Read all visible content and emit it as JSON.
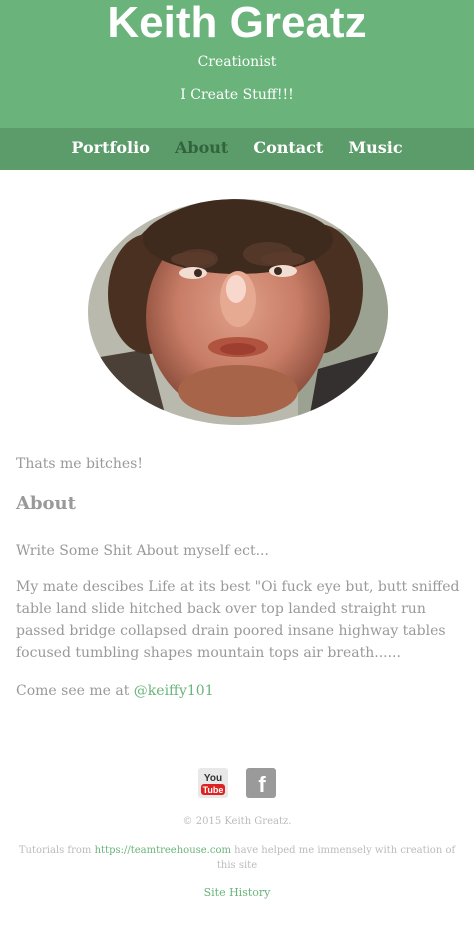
{
  "header": {
    "title": "Keith Greatz",
    "subtitle": "Creationist",
    "tagline": "I Create Stuff!!!"
  },
  "nav": {
    "items": [
      {
        "label": "Portfolio"
      },
      {
        "label": "About",
        "active": true
      },
      {
        "label": "Contact"
      },
      {
        "label": "Music"
      }
    ]
  },
  "profile": {
    "caption": "Thats me bitches!"
  },
  "about": {
    "heading": "About",
    "intro": "Write Some Shit About myself ect...",
    "body": "My mate descibes Life at its best \"Oi fuck eye but, butt sniffed table land slide hitched back over top landed straight run passed bridge collapsed drain poored insane highway tables focused tumbling shapes mountain tops air breath......",
    "contact_prefix": "Come see me at ",
    "twitter": "@keiffy101"
  },
  "social": {
    "youtube_icon": "youtube-icon",
    "youtube_top": "You",
    "youtube_bottom": "Tube",
    "facebook_icon": "facebook-icon",
    "facebook_glyph": "f"
  },
  "footer": {
    "copyright": "© 2015 Keith Greatz.",
    "tutorials_prefix": "Tutorials from ",
    "tutorials_link": "https://teamtreehouse.com",
    "tutorials_suffix": " have helped me immensely with creation of this site",
    "site_history": "Site History"
  },
  "colors": {
    "brand_green": "#6ab47b",
    "nav_green": "#5c9c6a",
    "active_nav": "#32643c",
    "text_grey": "#999999"
  }
}
